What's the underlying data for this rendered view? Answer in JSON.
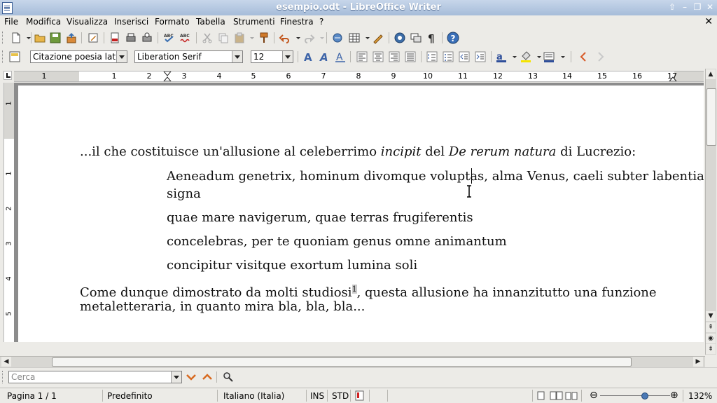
{
  "window": {
    "title": "esempio.odt - LibreOffice Writer",
    "btn_up": "⇧",
    "btn_min": "–",
    "btn_max": "❐",
    "btn_close": "✕"
  },
  "menu": {
    "items": [
      "File",
      "Modifica",
      "Visualizza",
      "Inserisci",
      "Formato",
      "Tabella",
      "Strumenti",
      "Finestra",
      "?"
    ],
    "close_doc": "✕"
  },
  "formatting": {
    "style": "Citazione poesia latin",
    "font": "Liberation Serif",
    "size": "12"
  },
  "ruler": {
    "numbers": [
      "1",
      "1",
      "2",
      "3",
      "4",
      "5",
      "6",
      "7",
      "8",
      "9",
      "10",
      "11",
      "12",
      "13",
      "14",
      "15",
      "16",
      "17"
    ],
    "vnumbers": [
      "1",
      "1",
      "2",
      "3",
      "4",
      "5"
    ]
  },
  "document": {
    "p1": {
      "a": "...il che costituisce un'allusione al celeberrimo ",
      "b": "incipit",
      "c": " del ",
      "d": "De rerum natura",
      "e": " di Lucrezio:"
    },
    "verse1a": "Aeneadum genetrix, hominum divomque voluptas, alma Venus, caeli subter labentia",
    "verse1b": "signa",
    "verse2": "quae mare navigerum, quae terras frugiferentis",
    "verse3": "concelebras, per te quoniam genus omne animantum",
    "verse4": "concipitur visitque exortum lumina soli",
    "p2a_pre": "Come dunque dimostrato da molti studiosi",
    "p2a_fn": "1",
    "p2a_post": ", questa allusione ha innanzitutto una funzione",
    "p2b": "metaletteraria, in quanto mira bla, bla, bla..."
  },
  "find": {
    "placeholder": "Cerca"
  },
  "status": {
    "page": "Pagina 1 / 1",
    "style": "Predefinito",
    "language": "Italiano (Italia)",
    "insert_mode": "INS",
    "selection_mode": "STD",
    "zoom": "132%",
    "zoom_level": 0.64
  }
}
